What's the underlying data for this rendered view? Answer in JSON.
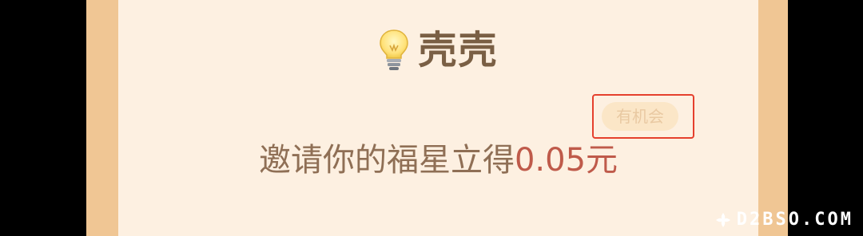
{
  "card": {
    "title": "壳壳",
    "title_icon": "lightbulb-icon",
    "badge_label": "有机会",
    "invite_text": "邀请你的福星立得",
    "invite_amount": "0.05元"
  },
  "watermark": {
    "text": "D2BSO.COM",
    "icon": "fleur-icon"
  },
  "colors": {
    "background": "#000000",
    "frame": "#f0c694",
    "card": "#fdf0e1",
    "title": "#7a5f44",
    "invite_text": "#8f6f55",
    "amount": "#bf5a4a",
    "highlight_box": "#e5402d",
    "badge_bg": "#fbe6c7",
    "badge_text": "#e9c9a2"
  }
}
